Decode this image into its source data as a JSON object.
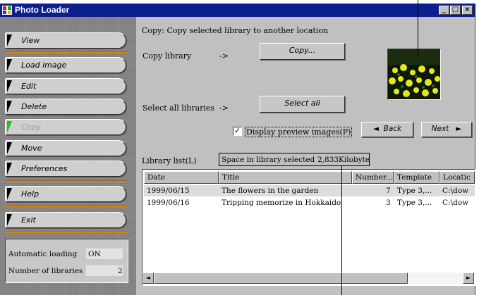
{
  "window": {
    "title": "Photo Loader",
    "min": "_",
    "max": "□",
    "close": "×"
  },
  "sidebar": {
    "items": [
      {
        "label": "View"
      },
      {
        "label": "Load image"
      },
      {
        "label": "Edit"
      },
      {
        "label": "Delete"
      },
      {
        "label": "Copy"
      },
      {
        "label": "Move"
      },
      {
        "label": "Preferences"
      },
      {
        "label": "Help"
      },
      {
        "label": "Exit"
      }
    ],
    "status": {
      "auto_label": "Automatic loading",
      "auto_value": "ON",
      "libs_label": "Number of libraries",
      "libs_value": "2"
    }
  },
  "main": {
    "description": "Copy: Copy selected library to another location",
    "copy_label": "Copy library",
    "copy_arrow": "->",
    "copy_button": "Copy...",
    "select_label": "Select all libraries",
    "select_arrow": "->",
    "select_button": "Select all",
    "preview_checkbox": "Display preview images(P)",
    "preview_checked": true,
    "back_button": "Back",
    "next_button": "Next",
    "library_list_label": "Library list(L)",
    "space_label": "Space in library selected",
    "space_value": "2,833Kilobyte"
  },
  "table": {
    "columns": [
      "Date",
      "Title",
      "Number...",
      "Template",
      "Locatic"
    ],
    "rows": [
      {
        "date": "1999/06/15",
        "title": "The flowers in the garden",
        "number": "7",
        "template": "Type 3,...",
        "location": "C:\\dow"
      },
      {
        "date": "1999/06/16",
        "title": "Tripping memorize in Hokkaido",
        "number": "3",
        "template": "Type 3,...",
        "location": "C:\\dow"
      }
    ]
  },
  "colors": {
    "titlebar": "#0b1f8f",
    "accent_separator": "#e7890f",
    "selected_row": "#dcdcdc"
  }
}
